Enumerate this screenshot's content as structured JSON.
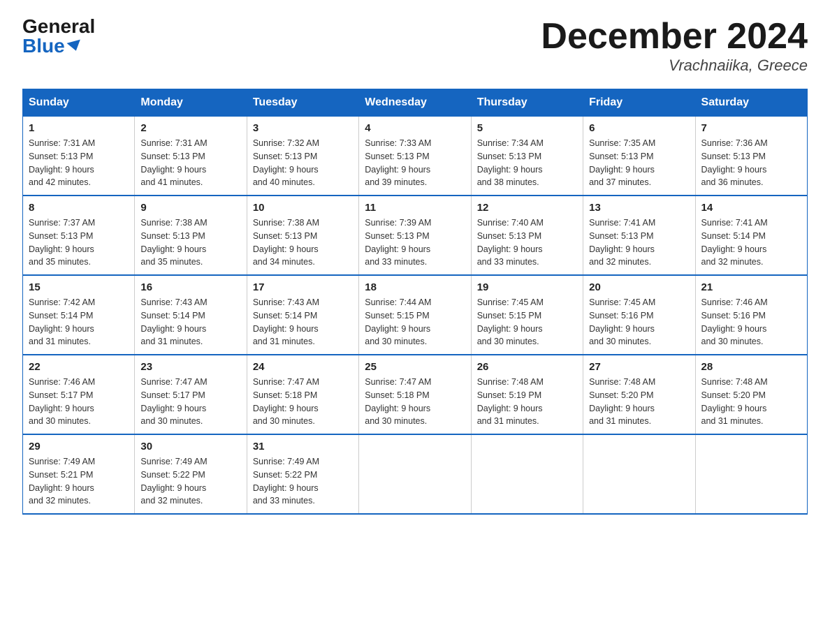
{
  "logo": {
    "general": "General",
    "blue": "Blue"
  },
  "title": "December 2024",
  "location": "Vrachnaiika, Greece",
  "headers": [
    "Sunday",
    "Monday",
    "Tuesday",
    "Wednesday",
    "Thursday",
    "Friday",
    "Saturday"
  ],
  "weeks": [
    [
      {
        "day": "1",
        "sunrise": "7:31 AM",
        "sunset": "5:13 PM",
        "daylight": "9 hours and 42 minutes."
      },
      {
        "day": "2",
        "sunrise": "7:31 AM",
        "sunset": "5:13 PM",
        "daylight": "9 hours and 41 minutes."
      },
      {
        "day": "3",
        "sunrise": "7:32 AM",
        "sunset": "5:13 PM",
        "daylight": "9 hours and 40 minutes."
      },
      {
        "day": "4",
        "sunrise": "7:33 AM",
        "sunset": "5:13 PM",
        "daylight": "9 hours and 39 minutes."
      },
      {
        "day": "5",
        "sunrise": "7:34 AM",
        "sunset": "5:13 PM",
        "daylight": "9 hours and 38 minutes."
      },
      {
        "day": "6",
        "sunrise": "7:35 AM",
        "sunset": "5:13 PM",
        "daylight": "9 hours and 37 minutes."
      },
      {
        "day": "7",
        "sunrise": "7:36 AM",
        "sunset": "5:13 PM",
        "daylight": "9 hours and 36 minutes."
      }
    ],
    [
      {
        "day": "8",
        "sunrise": "7:37 AM",
        "sunset": "5:13 PM",
        "daylight": "9 hours and 35 minutes."
      },
      {
        "day": "9",
        "sunrise": "7:38 AM",
        "sunset": "5:13 PM",
        "daylight": "9 hours and 35 minutes."
      },
      {
        "day": "10",
        "sunrise": "7:38 AM",
        "sunset": "5:13 PM",
        "daylight": "9 hours and 34 minutes."
      },
      {
        "day": "11",
        "sunrise": "7:39 AM",
        "sunset": "5:13 PM",
        "daylight": "9 hours and 33 minutes."
      },
      {
        "day": "12",
        "sunrise": "7:40 AM",
        "sunset": "5:13 PM",
        "daylight": "9 hours and 33 minutes."
      },
      {
        "day": "13",
        "sunrise": "7:41 AM",
        "sunset": "5:13 PM",
        "daylight": "9 hours and 32 minutes."
      },
      {
        "day": "14",
        "sunrise": "7:41 AM",
        "sunset": "5:14 PM",
        "daylight": "9 hours and 32 minutes."
      }
    ],
    [
      {
        "day": "15",
        "sunrise": "7:42 AM",
        "sunset": "5:14 PM",
        "daylight": "9 hours and 31 minutes."
      },
      {
        "day": "16",
        "sunrise": "7:43 AM",
        "sunset": "5:14 PM",
        "daylight": "9 hours and 31 minutes."
      },
      {
        "day": "17",
        "sunrise": "7:43 AM",
        "sunset": "5:14 PM",
        "daylight": "9 hours and 31 minutes."
      },
      {
        "day": "18",
        "sunrise": "7:44 AM",
        "sunset": "5:15 PM",
        "daylight": "9 hours and 30 minutes."
      },
      {
        "day": "19",
        "sunrise": "7:45 AM",
        "sunset": "5:15 PM",
        "daylight": "9 hours and 30 minutes."
      },
      {
        "day": "20",
        "sunrise": "7:45 AM",
        "sunset": "5:16 PM",
        "daylight": "9 hours and 30 minutes."
      },
      {
        "day": "21",
        "sunrise": "7:46 AM",
        "sunset": "5:16 PM",
        "daylight": "9 hours and 30 minutes."
      }
    ],
    [
      {
        "day": "22",
        "sunrise": "7:46 AM",
        "sunset": "5:17 PM",
        "daylight": "9 hours and 30 minutes."
      },
      {
        "day": "23",
        "sunrise": "7:47 AM",
        "sunset": "5:17 PM",
        "daylight": "9 hours and 30 minutes."
      },
      {
        "day": "24",
        "sunrise": "7:47 AM",
        "sunset": "5:18 PM",
        "daylight": "9 hours and 30 minutes."
      },
      {
        "day": "25",
        "sunrise": "7:47 AM",
        "sunset": "5:18 PM",
        "daylight": "9 hours and 30 minutes."
      },
      {
        "day": "26",
        "sunrise": "7:48 AM",
        "sunset": "5:19 PM",
        "daylight": "9 hours and 31 minutes."
      },
      {
        "day": "27",
        "sunrise": "7:48 AM",
        "sunset": "5:20 PM",
        "daylight": "9 hours and 31 minutes."
      },
      {
        "day": "28",
        "sunrise": "7:48 AM",
        "sunset": "5:20 PM",
        "daylight": "9 hours and 31 minutes."
      }
    ],
    [
      {
        "day": "29",
        "sunrise": "7:49 AM",
        "sunset": "5:21 PM",
        "daylight": "9 hours and 32 minutes."
      },
      {
        "day": "30",
        "sunrise": "7:49 AM",
        "sunset": "5:22 PM",
        "daylight": "9 hours and 32 minutes."
      },
      {
        "day": "31",
        "sunrise": "7:49 AM",
        "sunset": "5:22 PM",
        "daylight": "9 hours and 33 minutes."
      },
      null,
      null,
      null,
      null
    ]
  ],
  "labels": {
    "sunrise": "Sunrise:",
    "sunset": "Sunset:",
    "daylight": "Daylight:"
  }
}
